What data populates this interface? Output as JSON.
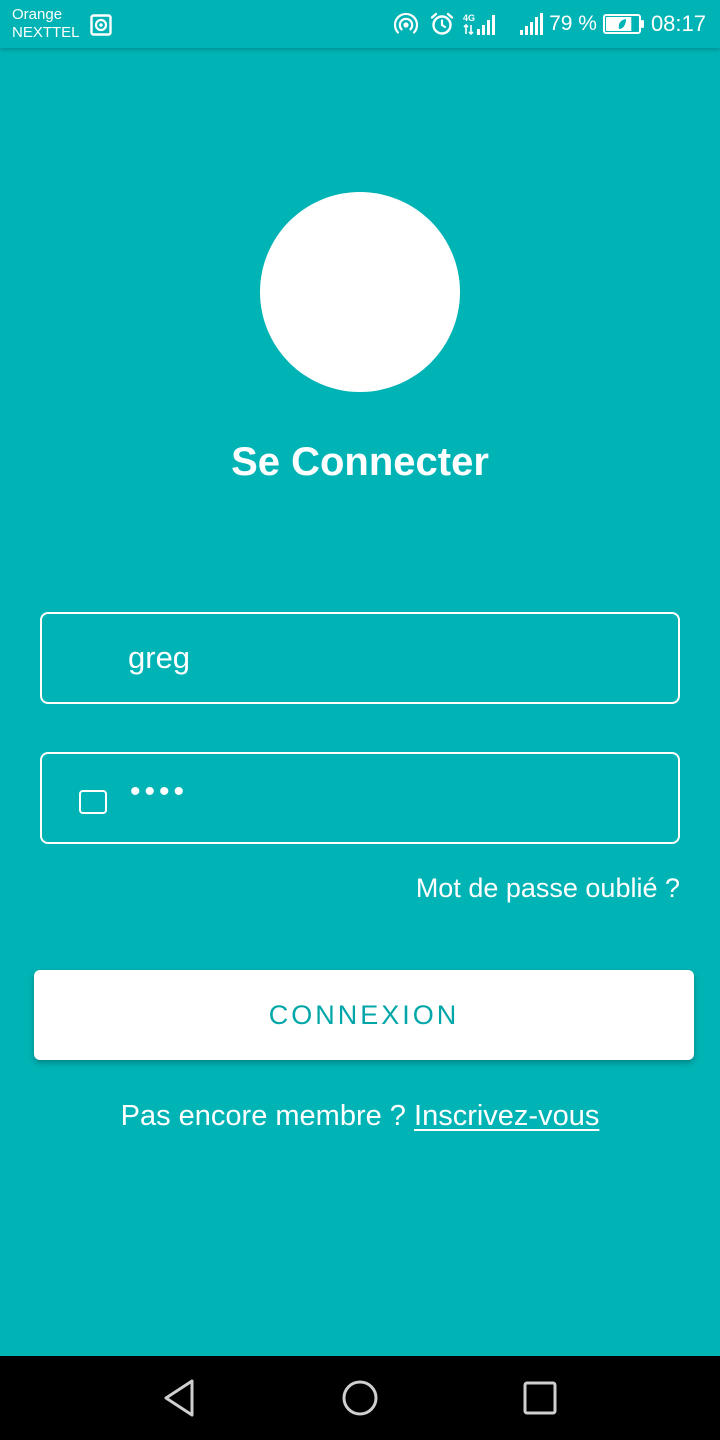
{
  "status_bar": {
    "carrier_line1": "Orange",
    "carrier_line2": "NEXTTEL",
    "battery_percent": "79 %",
    "battery_level": 0.79,
    "time": "08:17",
    "network_label": "4G",
    "icons": [
      "sim-icon",
      "hotspot-icon",
      "alarm-icon",
      "mobile-data-icon",
      "signal-icon",
      "battery-icon"
    ]
  },
  "main": {
    "title": "Se Connecter",
    "username_value": "greg",
    "password_value": "••••",
    "forgot_password": "Mot de passe oublié ?",
    "login_button": "CONNEXION",
    "signup_prompt": "Pas encore membre ?",
    "signup_link": "Inscrivez-vous"
  },
  "nav_bar": {
    "icons": [
      "back-icon",
      "home-icon",
      "recent-apps-icon"
    ]
  },
  "colors": {
    "background": "#00b3b5",
    "button_text": "#00a6a8",
    "foreground": "#ffffff"
  }
}
